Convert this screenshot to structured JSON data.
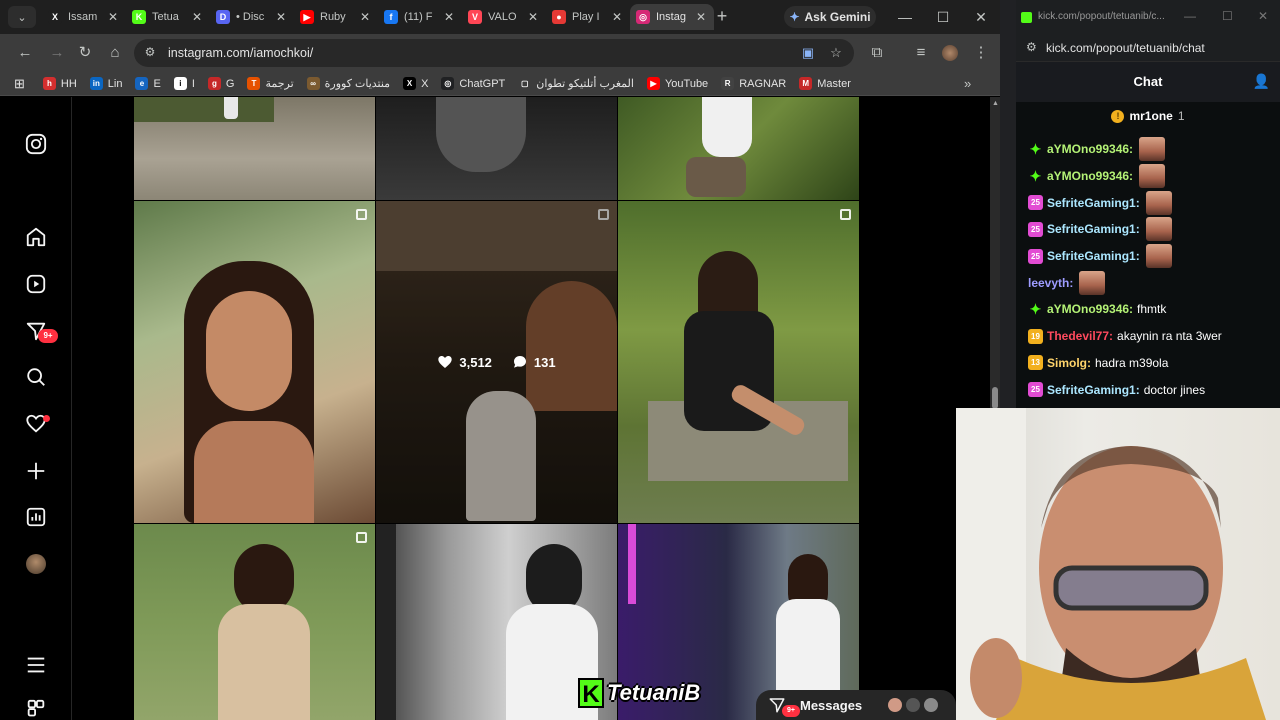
{
  "browser": {
    "tabs": [
      {
        "title": "Issam",
        "color": "#1f1f1f",
        "glyph": "X",
        "active": false
      },
      {
        "title": "Tetua",
        "color": "#53fc18",
        "glyph": "K",
        "active": false
      },
      {
        "title": "• Disc",
        "color": "#5865f2",
        "glyph": "D",
        "active": false
      },
      {
        "title": "Ruby",
        "color": "#ff0000",
        "glyph": "▶",
        "active": false
      },
      {
        "title": "(11) F",
        "color": "#1877f2",
        "glyph": "f",
        "active": false
      },
      {
        "title": "VALO",
        "color": "#ff4655",
        "glyph": "V",
        "active": false
      },
      {
        "title": "Play I",
        "color": "#e53935",
        "glyph": "●",
        "active": false
      },
      {
        "title": "Instag",
        "color": "#d62976",
        "glyph": "◎",
        "active": true
      }
    ],
    "gemini_label": "Ask Gemini",
    "url": "instagram.com/iamochkoi/",
    "bookmarks": [
      {
        "label": "HH",
        "color": "#d32f2f",
        "glyph": "h"
      },
      {
        "label": "Lin",
        "color": "#0a66c2",
        "glyph": "in"
      },
      {
        "label": "E",
        "color": "#1565c0",
        "glyph": "e"
      },
      {
        "label": "I",
        "color": "#ffffff",
        "glyph": "i"
      },
      {
        "label": "G",
        "color": "#c62828",
        "glyph": "g"
      },
      {
        "label": "ترجمة",
        "color": "#e65100",
        "glyph": "T"
      },
      {
        "label": "منتديات كوورة",
        "color": "#7b5a30",
        "glyph": "∞"
      },
      {
        "label": "X",
        "color": "#000000",
        "glyph": "X"
      },
      {
        "label": "ChatGPT",
        "color": "#202123",
        "glyph": "◎"
      },
      {
        "label": "المغرب أتلتيكو تطوان",
        "color": "#3c3c3c",
        "glyph": "▢"
      },
      {
        "label": "YouTube",
        "color": "#ff0000",
        "glyph": "▶"
      },
      {
        "label": "RAGNAR",
        "color": "#424242",
        "glyph": "R"
      },
      {
        "label": "Master",
        "color": "#c62828",
        "glyph": "M"
      }
    ]
  },
  "instagram": {
    "notification_count": "9+",
    "hovered_post": {
      "likes": "3,512",
      "comments": "131"
    },
    "messages_label": "Messages",
    "messages_badge": "9+"
  },
  "overlay": {
    "kick_name": "TetuaniB"
  },
  "kick": {
    "title_url": "kick.com/popout/tetuanib/c...",
    "url": "kick.com/popout/tetuanib/chat",
    "chat_title": "Chat",
    "pinned_user": "mr1one",
    "pinned_count": "1",
    "messages": [
      {
        "user": "aYMOno99346:",
        "color": "#b4f276",
        "badge": "✦",
        "badge_color": "#53fc18",
        "text": "",
        "emote": true
      },
      {
        "user": "aYMOno99346:",
        "color": "#b4f276",
        "badge": "✦",
        "badge_color": "#53fc18",
        "text": "",
        "emote": true
      },
      {
        "user": "SefriteGaming1:",
        "color": "#ace7ff",
        "badge": "25",
        "badge_color": "#e24cd3",
        "text": "",
        "emote": true
      },
      {
        "user": "SefriteGaming1:",
        "color": "#ace7ff",
        "badge": "25",
        "badge_color": "#e24cd3",
        "text": "",
        "emote": true
      },
      {
        "user": "SefriteGaming1:",
        "color": "#ace7ff",
        "badge": "25",
        "badge_color": "#e24cd3",
        "text": "",
        "emote": true
      },
      {
        "user": "leevyth:",
        "color": "#9e9cff",
        "badge": "",
        "badge_color": "",
        "text": "",
        "emote": true
      },
      {
        "user": "aYMOno99346:",
        "color": "#b4f276",
        "badge": "✦",
        "badge_color": "#53fc18",
        "text": "fhmtk",
        "emote": false
      },
      {
        "user": "Thedevil77:",
        "color": "#ff4a5e",
        "badge": "19",
        "badge_color": "#f2b01e",
        "text": "akaynin ra nta 3wer",
        "emote": false
      },
      {
        "user": "Simolg:",
        "color": "#ffd46b",
        "badge": "13",
        "badge_color": "#f2b01e",
        "text": "hadra m39ola",
        "emote": false
      },
      {
        "user": "SefriteGaming1:",
        "color": "#ace7ff",
        "badge": "25",
        "badge_color": "#e24cd3",
        "text": "doctor jines",
        "emote": false
      }
    ]
  }
}
